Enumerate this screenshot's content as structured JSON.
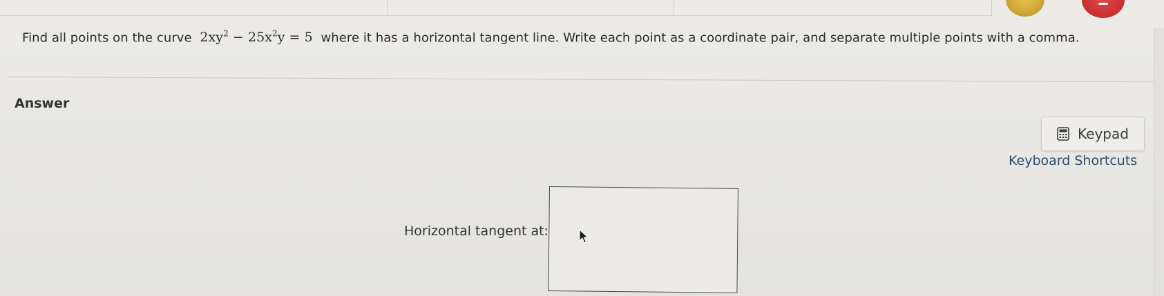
{
  "question": {
    "prefix": "Find all points on the curve",
    "equation": {
      "t1_coef": "2xy",
      "t1_exp": "2",
      "minus": " − ",
      "t2_coef": "25x",
      "t2_exp": "2",
      "t2_tail": "y = 5"
    },
    "suffix": "where it has a horizontal tangent line. Write each point as a coordinate pair, and separate multiple points with a comma."
  },
  "answer": {
    "section_label": "Answer",
    "keypad_label": "Keypad",
    "keypad_icon": "calculator-icon",
    "shortcuts_label": "Keyboard Shortcuts",
    "field_label": "Horizontal tangent at:",
    "field_value": ""
  },
  "colors": {
    "link": "#2d4f6f",
    "heart_badge": "#d63a3b",
    "gold_badge": "#d4ae3d"
  }
}
